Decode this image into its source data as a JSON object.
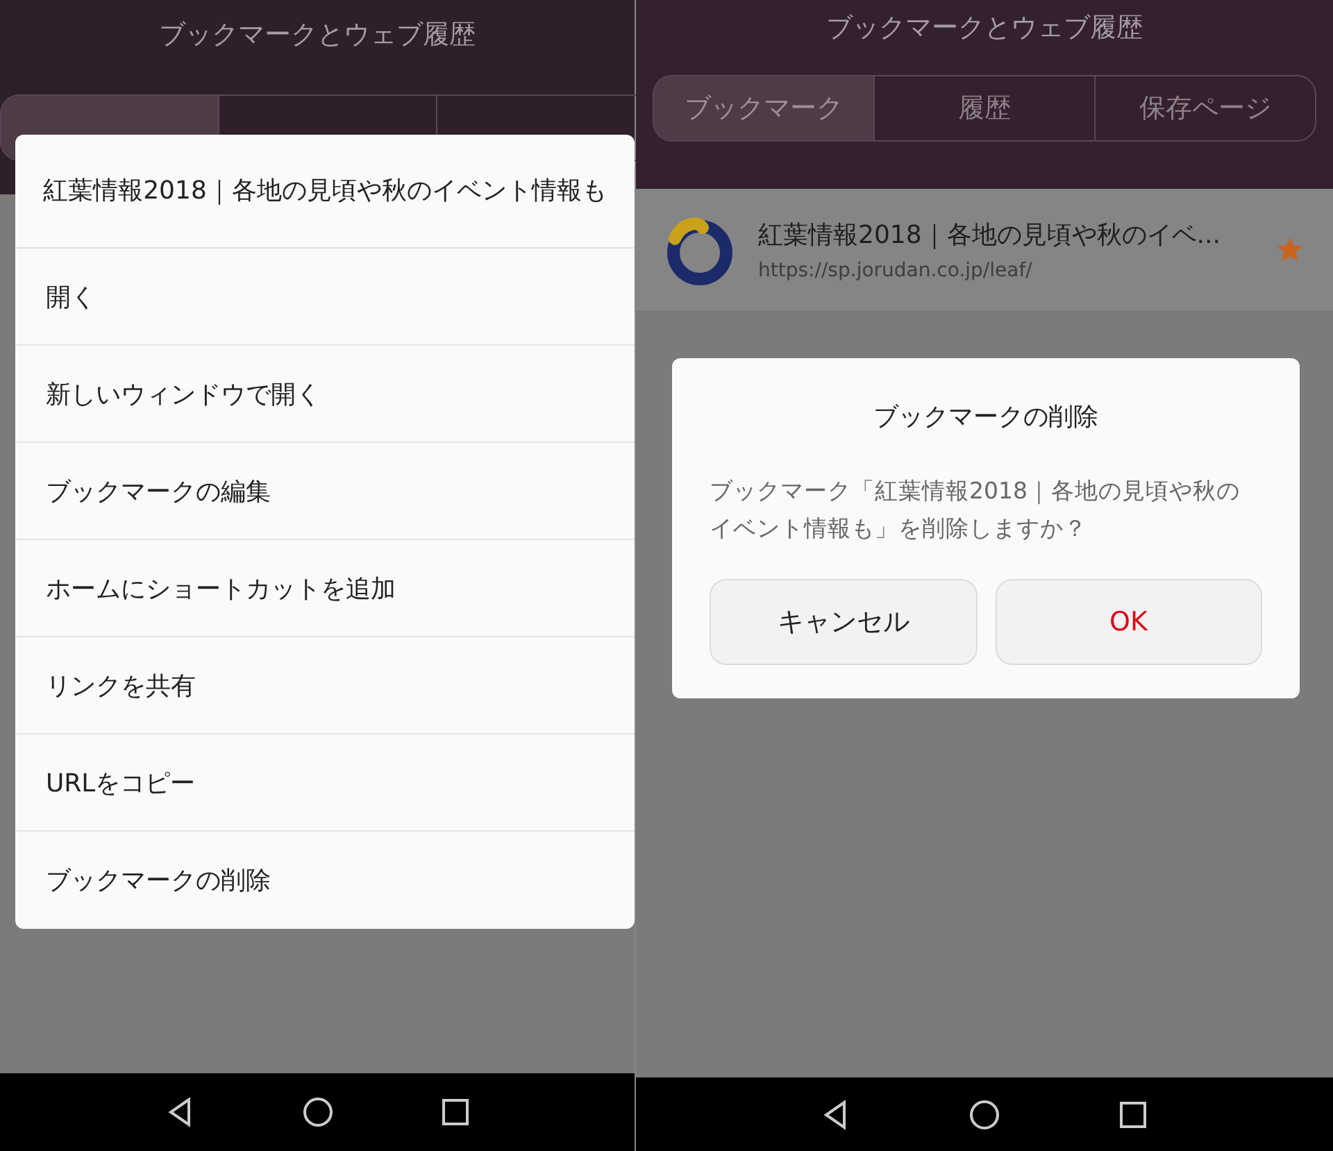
{
  "screens": [
    {
      "header": {
        "title": "ブックマークとウェブ履歴"
      },
      "tabs": [
        {
          "selected": true
        },
        {
          "selected": false
        },
        {
          "selected": false
        }
      ],
      "context_menu": {
        "title": "紅葉情報2018｜各地の見頃や秋のイベント情報も",
        "items": [
          "開く",
          "新しいウィンドウで開く",
          "ブックマークの編集",
          "ホームにショートカットを追加",
          "リンクを共有",
          "URLをコピー",
          "ブックマークの削除"
        ]
      }
    },
    {
      "header": {
        "title": "ブックマークとウェブ履歴"
      },
      "tabs": [
        {
          "label": "ブックマーク",
          "selected": true
        },
        {
          "label": "履歴",
          "selected": false
        },
        {
          "label": "保存ページ",
          "selected": false
        }
      ],
      "bookmarks": [
        {
          "title": "紅葉情報2018｜各地の見頃や秋のイベ...",
          "url": "https://sp.jorudan.co.jp/leaf/",
          "starred": true
        }
      ],
      "dialog": {
        "title": "ブックマークの削除",
        "message": "ブックマーク「紅葉情報2018｜各地の見頃や秋のイベント情報も」を削除しますか？",
        "buttons": [
          {
            "label": "キャンセル",
            "kind": "cancel"
          },
          {
            "label": "OK",
            "kind": "confirm"
          }
        ]
      }
    }
  ]
}
